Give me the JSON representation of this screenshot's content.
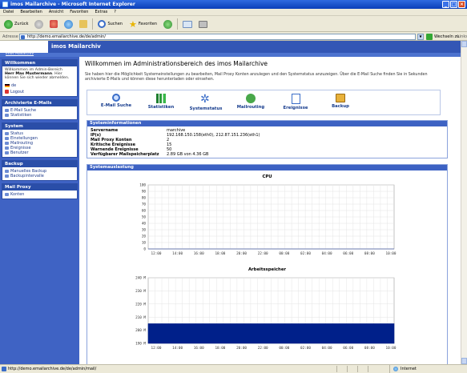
{
  "window": {
    "title": "imos Mailarchive - Microsoft Internet Explorer"
  },
  "menu": [
    "Datei",
    "Bearbeiten",
    "Ansicht",
    "Favoriten",
    "Extras",
    "?"
  ],
  "toolbar": {
    "back": "Zurück",
    "search": "Suchen",
    "favorites": "Favoriten"
  },
  "address": {
    "label": "Adresse",
    "url": "http://demo.emailarchive.de/de/admin/",
    "go": "Wechseln zu",
    "links": "Links"
  },
  "header": {
    "title": "imos Mailarchiv",
    "sublink": "imos Mailarchiv"
  },
  "sidebar": {
    "welcome": {
      "heading": "Willkommen",
      "line1": "Willkommen im Admin-Bereich",
      "name": "Herr Max Mustermann",
      "line2": "Hier können Sie sich wieder abmelden.",
      "lang": "de",
      "logout": "Logout"
    },
    "sections": [
      {
        "heading": "Archivierte E-Mails",
        "items": [
          "E-Mail Suche",
          "Statistiken"
        ]
      },
      {
        "heading": "System",
        "items": [
          "Status",
          "Einstellungen",
          "Mailrouting",
          "Ereignisse",
          "Benutzer"
        ]
      },
      {
        "heading": "Backup",
        "items": [
          "Manuelles Backup",
          "Backupintervalle"
        ]
      },
      {
        "heading": "Mail Proxy",
        "items": [
          "Konten"
        ]
      }
    ]
  },
  "main": {
    "title": "Willkommen im Administrationsbereich des imos Mailarchive",
    "intro": "Sie haben hier die Möglichkeit Systemeinstellungen zu bearbeiten, Mail Proxy Konten anzulegen und den Systemstatus anzuzeigen. Über die E-Mail Suche finden Sie in Sekunden archivierte E-Mails und können diese herunterladen oder einsehen.",
    "icons": [
      {
        "label": "E-Mail Suche",
        "icon": "magnifier-icon"
      },
      {
        "label": "Statistiken",
        "icon": "bar-chart-icon"
      },
      {
        "label": "Systemstatus",
        "icon": "gear-icon"
      },
      {
        "label": "Mailrouting",
        "icon": "routing-icon"
      },
      {
        "label": "Ereignisse",
        "icon": "events-icon"
      },
      {
        "label": "Backup",
        "icon": "backup-icon"
      }
    ],
    "sysinfo": {
      "heading": "Systeminformationen",
      "rows": [
        {
          "k": "Servername",
          "v": "marchive"
        },
        {
          "k": "IP(s)",
          "v": "192.168.150.158(eth0), 212.87.151.236(eth1)"
        },
        {
          "k": "Mail Proxy Konten",
          "v": "2"
        },
        {
          "k": "Kritische Ereignisse",
          "v": "15"
        },
        {
          "k": "Warnende Ereignisse",
          "v": "50"
        },
        {
          "k": "Verfügbarer Mailspeicherplatz",
          "v": "2.89 GB von 4.36 GB"
        }
      ]
    },
    "usage_heading": "Systemauslastung"
  },
  "chart_data": [
    {
      "type": "area",
      "title": "CPU",
      "x": [
        "12:00",
        "14:00",
        "16:00",
        "18:00",
        "20:00",
        "22:00",
        "00:00",
        "02:00",
        "04:00",
        "06:00",
        "08:00",
        "10:00"
      ],
      "yticks": [
        "100",
        "90",
        "80",
        "70",
        "60",
        "50",
        "40",
        "30",
        "20",
        "10",
        "0"
      ],
      "ylim": [
        0,
        100
      ],
      "values": [
        0,
        0,
        0,
        0,
        0,
        0,
        0,
        0,
        0,
        0,
        0,
        0
      ],
      "color": "#00208a"
    },
    {
      "type": "area",
      "title": "Arbeitsspeicher",
      "x": [
        "12:00",
        "14:00",
        "16:00",
        "18:00",
        "20:00",
        "22:00",
        "00:00",
        "02:00",
        "04:00",
        "06:00",
        "08:00",
        "10:00"
      ],
      "yticks": [
        "240 M",
        "230 M",
        "220 M",
        "210 M",
        "200 M",
        "190 M"
      ],
      "ylim": [
        190,
        240
      ],
      "values": [
        205,
        205,
        205,
        205,
        205,
        205,
        205,
        205,
        205,
        205,
        205,
        205
      ],
      "color": "#00208a"
    }
  ],
  "statusbar": {
    "url": "http://demo.emailarchive.de/de/admin/mail/",
    "zone": "Internet"
  }
}
